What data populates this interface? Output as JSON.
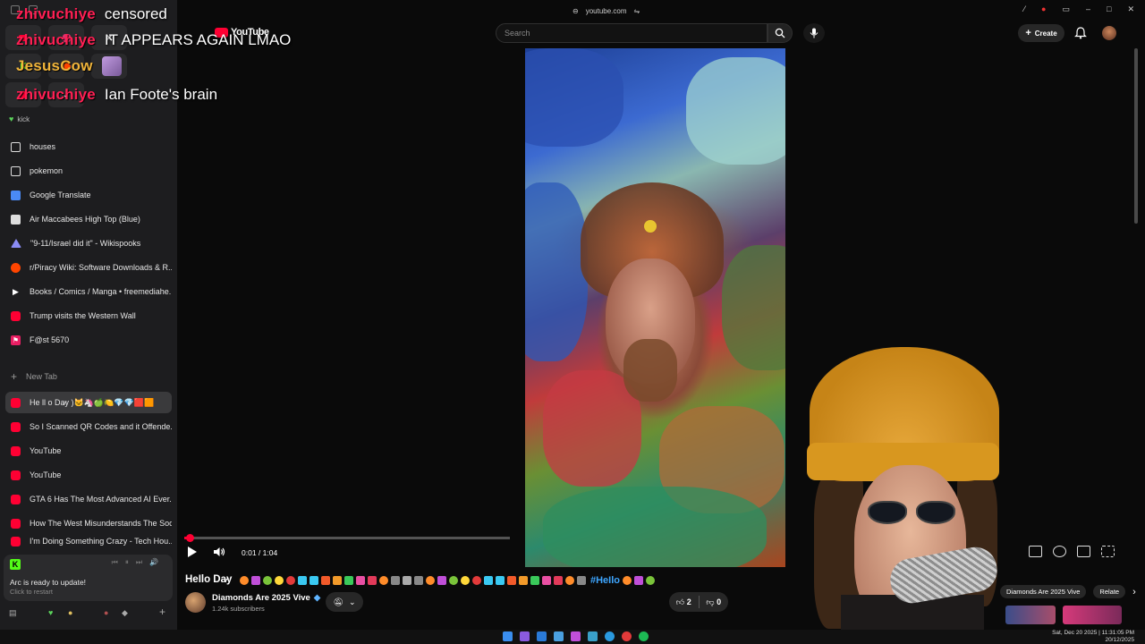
{
  "browser": {
    "url": "youtube.com"
  },
  "chat": [
    {
      "user": "zhivuchiye",
      "message": "censored",
      "badge": ""
    },
    {
      "user": "zhivuchiye",
      "message": "IT APPEARS AGAIN LMAO",
      "badge": ""
    },
    {
      "user": "JesusCow",
      "message": "",
      "badge": "K"
    },
    {
      "user": "zhivuchiye",
      "message": "Ian Foote's brain",
      "badge": ""
    }
  ],
  "sidebar": {
    "kick_label": "kick",
    "pinned": [
      {
        "label": "houses",
        "icon": "folder-icon"
      },
      {
        "label": "pokemon",
        "icon": "folder-icon"
      },
      {
        "label": "Google Translate",
        "icon": "translate-icon"
      },
      {
        "label": "Air Maccabees High Top (Blue)",
        "icon": "page-icon"
      },
      {
        "label": "\"9-11/Israel did it\" - Wikispooks",
        "icon": "triangle-icon"
      },
      {
        "label": "r/Piracy Wiki: Software Downloads & R...",
        "icon": "reddit-icon"
      },
      {
        "label": "Books / Comics / Manga • freemediahe...",
        "icon": "play-icon"
      },
      {
        "label": "Trump visits the Western Wall",
        "icon": "youtube-icon"
      },
      {
        "label": "F@st 5670",
        "icon": "pink-icon"
      }
    ],
    "new_tab": "New Tab",
    "tabs": [
      {
        "label": "He ll o Da̷y )🐱🦄🍏🍋💎💎🟥🟧",
        "active": true
      },
      {
        "label": "So I Scanned QR Codes and it Offende...",
        "active": false
      },
      {
        "label": "YouTube",
        "active": false
      },
      {
        "label": "YouTube",
        "active": false
      },
      {
        "label": "GTA 6 Has The Most Advanced AI Ever...",
        "active": false
      },
      {
        "label": "How The West Misunderstands The Soc...",
        "active": false
      },
      {
        "label": "I'm Doing Something Crazy - Tech Hou...",
        "active": false
      }
    ],
    "update_title": "Arc is ready to update!",
    "update_subtitle": "Click to restart"
  },
  "youtube": {
    "logo_text": "YouTube",
    "search_placeholder": "Search",
    "create_label": "Create",
    "time": "0:01 / 1:04",
    "progress_fraction": 0.016,
    "video_title_prefix": "HeIlo Da̷y",
    "video_title_suffix": "#HeIlo",
    "channel_name": "Diamonds Are 2025 Vive",
    "subscribers": "1.24k subscribers",
    "likes": "2",
    "dislikes": "0",
    "related_chips": [
      "Diamonds Are 2025 Vive",
      "Relate"
    ]
  },
  "taskbar": {
    "datetime": "Sat, Dec 20 2025 | 11:31:05 PM",
    "date": "20/12/2025"
  },
  "colors": {
    "youtube_red": "#ff0033",
    "chat_user": "#ff1f53",
    "jesuscow": "#f0b43a",
    "kick_green": "#53fc18"
  }
}
